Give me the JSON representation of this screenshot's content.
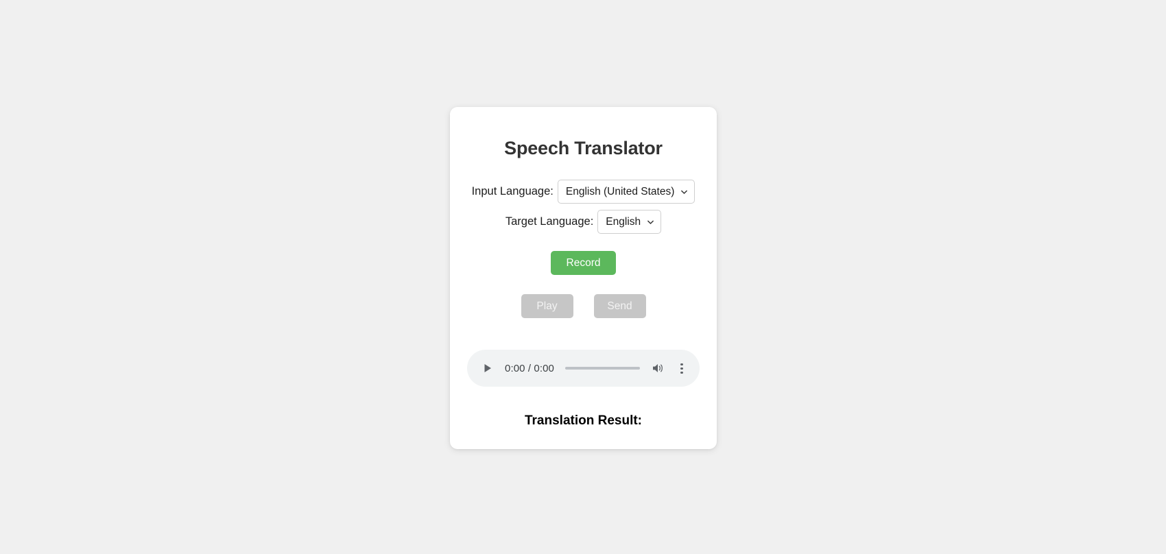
{
  "app": {
    "title": "Speech Translator"
  },
  "background_color": "#f0f0f0",
  "card_color": "#ffffff",
  "form": {
    "input_language": {
      "label": "Input Language:",
      "selected": "English (United States)",
      "icon": "chevron-down-icon"
    },
    "target_language": {
      "label": "Target Language:",
      "selected": "English",
      "icon": "chevron-down-icon"
    }
  },
  "controls": {
    "record": {
      "label": "Record",
      "color": "#5cb85c",
      "text_color": "#ffffff",
      "enabled": true
    },
    "play": {
      "label": "Play",
      "color": "#c6c6c6",
      "text_color": "#f3f3f3",
      "enabled": false
    },
    "send": {
      "label": "Send",
      "color": "#c6c6c6",
      "text_color": "#f3f3f3",
      "enabled": false
    }
  },
  "audio_player": {
    "play_icon": "play-icon",
    "time_display": "0:00 / 0:00",
    "current_time": "0:00",
    "duration": "0:00",
    "progress_percent": 0,
    "volume_icon": "volume-icon",
    "menu_icon": "more-vertical-icon",
    "background_color": "#f1f3f4"
  },
  "result": {
    "heading": "Translation Result:",
    "text": ""
  }
}
